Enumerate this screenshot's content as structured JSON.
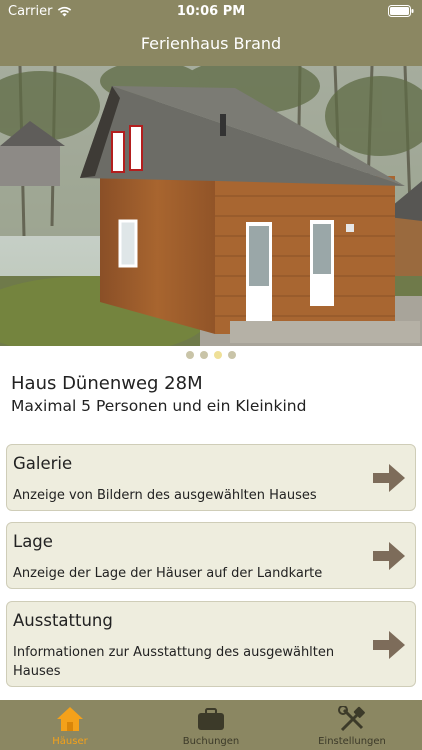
{
  "status_bar": {
    "carrier": "Carrier",
    "time": "10:06 PM"
  },
  "nav": {
    "title": "Ferienhaus Brand"
  },
  "house": {
    "name": "Haus Dünenweg 28M",
    "capacity": "Maximal 5 Personen und ein Kleinkind"
  },
  "carousel": {
    "page_count": 4,
    "active_index": 2
  },
  "cards": [
    {
      "title": "Galerie",
      "description": "Anzeige von Bildern des ausgewählten Hauses"
    },
    {
      "title": "Lage",
      "description": "Anzeige der Lage der Häuser auf der Landkarte"
    },
    {
      "title": "Ausstattung",
      "description": "Informationen zur Ausstattung des ausgewählten Hauses"
    }
  ],
  "tabs": [
    {
      "label": "Häuser",
      "icon": "house-icon",
      "active": true
    },
    {
      "label": "Buchungen",
      "icon": "briefcase-icon",
      "active": false
    },
    {
      "label": "Einstellungen",
      "icon": "tools-icon",
      "active": false
    }
  ],
  "colors": {
    "bar": "#8b8762",
    "card_bg": "#eeedde",
    "arrow": "#7d6c5a",
    "tab_active": "#f4a11a"
  }
}
